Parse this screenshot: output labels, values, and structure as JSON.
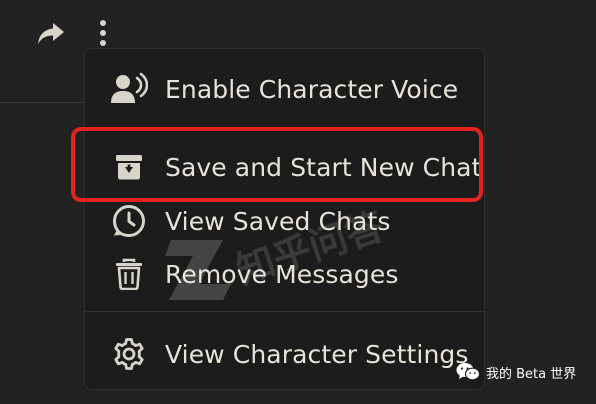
{
  "toolbar": {
    "share_icon": "share-forward-icon",
    "more_icon": "more-vertical-icon"
  },
  "menu": {
    "items": [
      {
        "label": "Enable Character Voice",
        "icon": "voice-person-icon"
      },
      {
        "label": "Save and Start New Chat",
        "icon": "archive-box-icon",
        "highlighted": true
      },
      {
        "label": "View Saved Chats",
        "icon": "clock-history-icon"
      },
      {
        "label": "Remove Messages",
        "icon": "trash-icon"
      },
      {
        "label": "View Character Settings",
        "icon": "gear-icon"
      }
    ]
  },
  "annotation": {
    "highlight_color": "#e2231f"
  },
  "watermark": {
    "text": "知乎问答"
  },
  "credit": {
    "text": "我的 Beta 世界"
  },
  "colors": {
    "background": "#222222",
    "menu_background": "#1c1c1c",
    "text": "#e7e3d8",
    "icon": "#d8d4ca"
  }
}
